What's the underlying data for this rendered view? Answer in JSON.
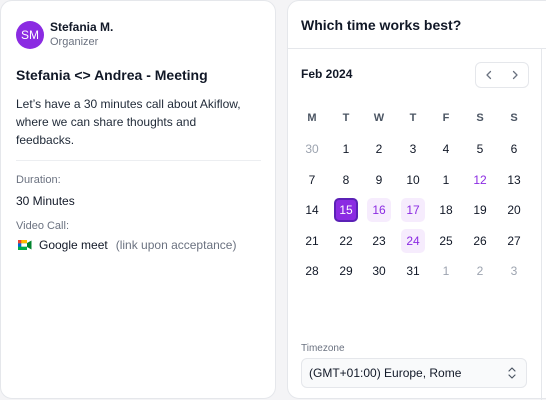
{
  "organizer": {
    "initials": "SM",
    "name": "Stefania M.",
    "role": "Organizer"
  },
  "meeting": {
    "title": "Stefania <> Andrea - Meeting",
    "description": "Let’s have a 30 minutes call about Akiflow, where we can share thoughts and feedbacks.",
    "duration_label": "Duration:",
    "duration_value": "30 Minutes",
    "video_label": "Video Call:",
    "video_provider": "Google meet",
    "video_note": "(link upon acceptance)"
  },
  "scheduler": {
    "title": "Which time works best?",
    "month": "Feb 2024",
    "weekdays": [
      "M",
      "T",
      "W",
      "T",
      "F",
      "S",
      "S"
    ],
    "weeks": [
      [
        {
          "d": "30",
          "s": "muted"
        },
        {
          "d": "1"
        },
        {
          "d": "2"
        },
        {
          "d": "3"
        },
        {
          "d": "4"
        },
        {
          "d": "5"
        },
        {
          "d": "6"
        }
      ],
      [
        {
          "d": "7"
        },
        {
          "d": "8"
        },
        {
          "d": "9"
        },
        {
          "d": "10"
        },
        {
          "d": "1"
        },
        {
          "d": "12",
          "s": "avail-text"
        },
        {
          "d": "13"
        }
      ],
      [
        {
          "d": "14"
        },
        {
          "d": "15",
          "s": "selected"
        },
        {
          "d": "16",
          "s": "avail"
        },
        {
          "d": "17",
          "s": "avail"
        },
        {
          "d": "18"
        },
        {
          "d": "19"
        },
        {
          "d": "20"
        }
      ],
      [
        {
          "d": "21"
        },
        {
          "d": "22"
        },
        {
          "d": "23"
        },
        {
          "d": "24",
          "s": "avail"
        },
        {
          "d": "25"
        },
        {
          "d": "26"
        },
        {
          "d": "27"
        }
      ],
      [
        {
          "d": "28"
        },
        {
          "d": "29"
        },
        {
          "d": "30"
        },
        {
          "d": "31"
        },
        {
          "d": "1",
          "s": "muted"
        },
        {
          "d": "2",
          "s": "muted"
        },
        {
          "d": "3",
          "s": "muted"
        }
      ]
    ],
    "timezone_label": "Timezone",
    "timezone_value": "(GMT+01:00) Europe, Rome"
  },
  "colors": {
    "accent": "#8b2be2",
    "accent_soft": "#f6ecfd"
  },
  "icons": {
    "prev": "chevron-left-icon",
    "next": "chevron-right-icon",
    "meet": "google-meet-icon",
    "select": "chevron-up-down-icon"
  }
}
